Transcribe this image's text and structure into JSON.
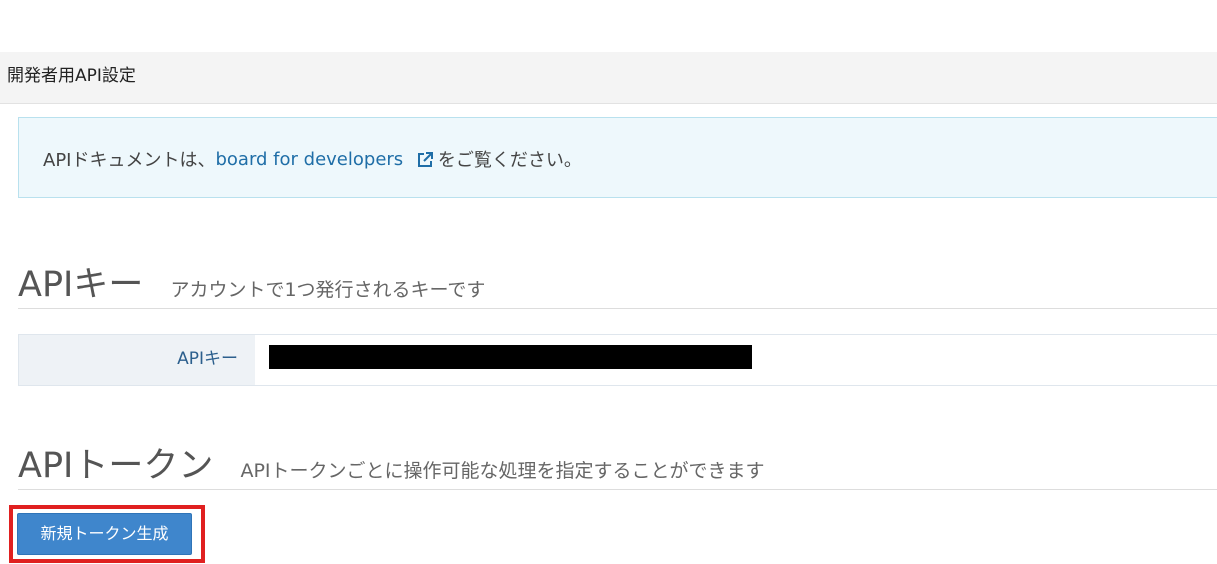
{
  "header": {
    "title": "開発者用API設定"
  },
  "info": {
    "prefix": "APIドキュメントは、",
    "link_text": "board for developers",
    "link_icon": "external-link-icon",
    "suffix": "をご覧ください。"
  },
  "api_key_section": {
    "title": "APIキー",
    "subtitle": "アカウントで1つ発行されるキーです",
    "field_label": "APIキー",
    "field_value_state": "redacted"
  },
  "api_token_section": {
    "title": "APIトークン",
    "subtitle": "APIトークンごとに操作可能な処理を指定することができます",
    "new_token_button": "新規トークン生成"
  },
  "colors": {
    "accent": "#3f86cc",
    "link": "#1f6ea7",
    "highlight": "#e02020",
    "info_bg": "#eef8fc"
  }
}
